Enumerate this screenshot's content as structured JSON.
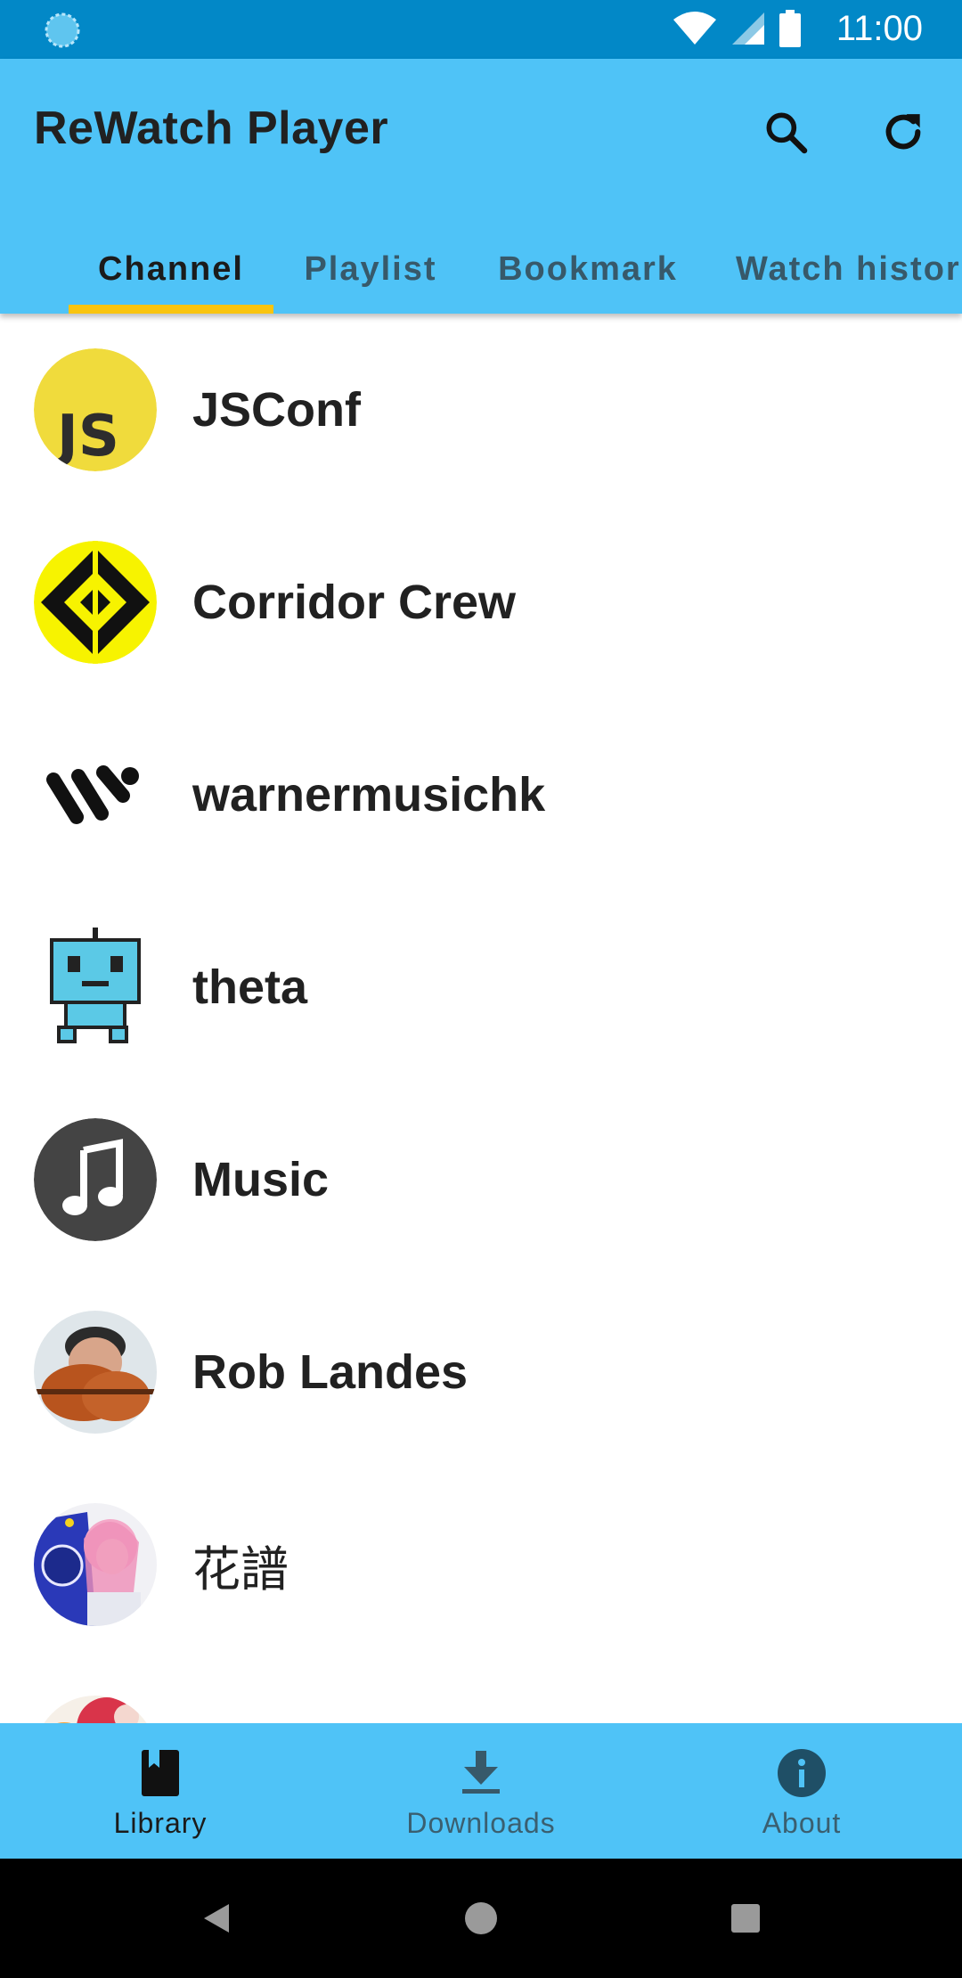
{
  "status_bar": {
    "time": "11:00",
    "icons": [
      "sync-icon",
      "wifi-icon",
      "signal-icon",
      "battery-icon"
    ],
    "bg_color": "#0288c7"
  },
  "app_bar": {
    "title": "ReWatch Player",
    "actions": [
      "search-icon",
      "refresh-icon"
    ],
    "bg_color": "#4fc3f7"
  },
  "tabs": [
    {
      "label": "Channel",
      "active": true
    },
    {
      "label": "Playlist",
      "active": false
    },
    {
      "label": "Bookmark",
      "active": false
    },
    {
      "label": "Watch histor",
      "active": false
    }
  ],
  "accent_color": "#f9c40f",
  "channels": [
    {
      "name": "JSConf",
      "avatar": "js-logo-icon"
    },
    {
      "name": "Corridor Crew",
      "avatar": "corridor-crew-logo-icon"
    },
    {
      "name": "warnermusichk",
      "avatar": "warner-music-logo-icon"
    },
    {
      "name": "theta",
      "avatar": "robot-avatar-icon"
    },
    {
      "name": "Music",
      "avatar": "music-note-icon"
    },
    {
      "name": "Rob Landes",
      "avatar": "violinist-photo"
    },
    {
      "name": "花譜",
      "avatar": "anime-art-photo"
    },
    {
      "name": "",
      "avatar": "partial-avatar-photo"
    }
  ],
  "bottom_nav": [
    {
      "label": "Library",
      "icon": "library-book-icon",
      "active": true
    },
    {
      "label": "Downloads",
      "icon": "download-icon",
      "active": false
    },
    {
      "label": "About",
      "icon": "info-icon",
      "active": false
    }
  ],
  "system_nav": [
    "back-icon",
    "home-icon",
    "recents-icon"
  ]
}
